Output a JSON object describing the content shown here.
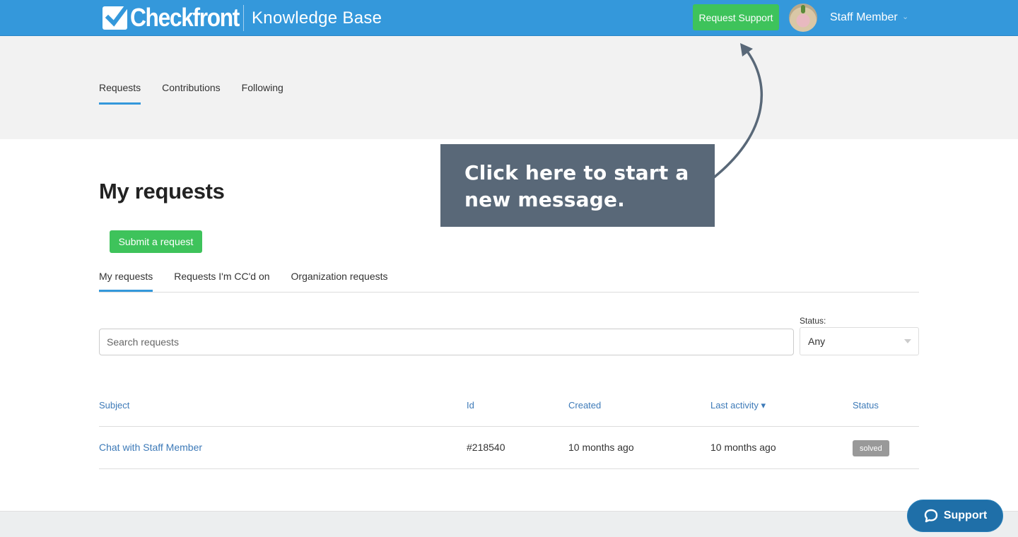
{
  "header": {
    "logo_text": "Checkfront",
    "title": "Knowledge Base",
    "request_support_label": "Request Support",
    "user_name": "Staff Member",
    "user_chevron": "⌄",
    "brand_color": "#3498db"
  },
  "subnav": {
    "items": [
      {
        "label": "Requests",
        "active": true
      },
      {
        "label": "Contributions",
        "active": false
      },
      {
        "label": "Following",
        "active": false
      }
    ]
  },
  "main": {
    "title": "My requests",
    "submit_label": "Submit a request",
    "tabs": [
      {
        "label": "My requests",
        "active": true
      },
      {
        "label": "Requests I'm CC'd on",
        "active": false
      },
      {
        "label": "Organization requests",
        "active": false
      }
    ],
    "search": {
      "placeholder": "Search requests"
    },
    "status_filter": {
      "label": "Status:",
      "value": "Any"
    }
  },
  "table": {
    "columns": [
      "Subject",
      "Id",
      "Created",
      "Last activity ▾",
      "Status"
    ],
    "rows": [
      {
        "subject": "Chat with Staff Member",
        "id": "#218540",
        "created": "10 months ago",
        "last_activity": "10 months ago",
        "status": "solved"
      }
    ]
  },
  "callout": {
    "text_line1": "Click here to start a",
    "text_line2": "new message."
  },
  "support_widget": {
    "label": "Support"
  },
  "colors": {
    "accent": "#3498db",
    "success": "#3ec35b",
    "callout": "#596878",
    "badge": "#999999"
  }
}
